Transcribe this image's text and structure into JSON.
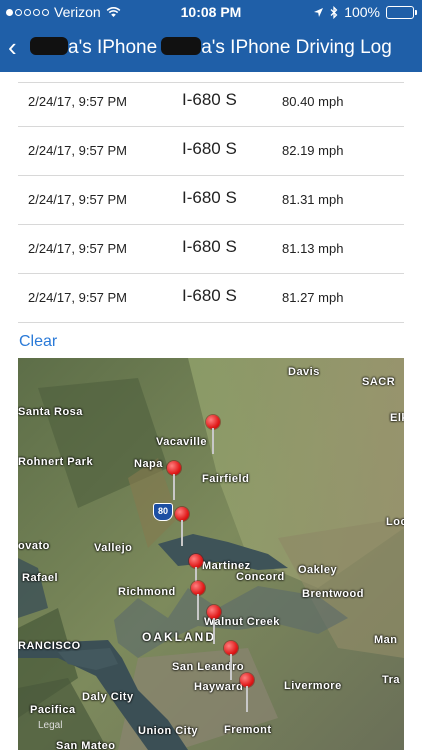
{
  "status_bar": {
    "carrier": "Verizon",
    "time": "10:08 PM",
    "battery": "100%",
    "battery_level": 1.0
  },
  "nav": {
    "back_label": "‹",
    "title_part1": "a's IPhone",
    "title_part2": "a's IPhone Driving Log"
  },
  "log": {
    "rows": [
      {
        "date": "2/24/17, 9:57 PM",
        "road": "I-680 S",
        "speed": "80.40 mph"
      },
      {
        "date": "2/24/17, 9:57 PM",
        "road": "I-680 S",
        "speed": "82.19 mph"
      },
      {
        "date": "2/24/17, 9:57 PM",
        "road": "I-680 S",
        "speed": "81.31 mph"
      },
      {
        "date": "2/24/17, 9:57 PM",
        "road": "I-680 S",
        "speed": "81.13 mph"
      },
      {
        "date": "2/24/17, 9:57 PM",
        "road": "I-680 S",
        "speed": "81.27 mph"
      }
    ]
  },
  "clear_label": "Clear",
  "map": {
    "cities": [
      "Davis",
      "SACR",
      "Santa Rosa",
      "Elk",
      "Vacaville",
      "Rohnert Park",
      "Napa",
      "Fairfield",
      "80",
      "Loc",
      "ovato",
      "Vallejo",
      "Martinez",
      "Oakley",
      "Rafael",
      "Concord",
      "Richmond",
      "Brentwood",
      "Walnut Creek",
      "RANCISCO",
      "OAKLAND",
      "Man",
      "San Leandro",
      "Tra",
      "Hayward",
      "Livermore",
      "Daly City",
      "Pacifica",
      "Union City",
      "Fremont",
      "San Mateo",
      "Legal"
    ],
    "pins": 8
  }
}
